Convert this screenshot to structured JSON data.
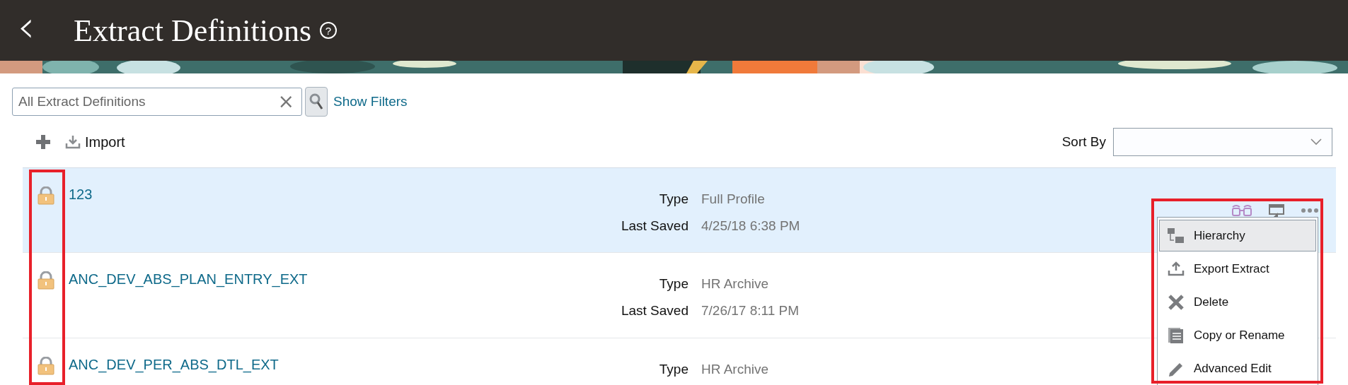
{
  "header": {
    "back": "‹",
    "title": "Extract Definitions",
    "help": "?"
  },
  "search": {
    "value": "All Extract Definitions",
    "clear": "×",
    "show_filters": "Show Filters"
  },
  "toolbar": {
    "import": "Import",
    "sort_label": "Sort By"
  },
  "rows": [
    {
      "name": "123",
      "locked": true,
      "selected": true,
      "fields": [
        {
          "label": "Type",
          "value": "Full Profile"
        },
        {
          "label": "Last Saved",
          "value": "4/25/18 6:38 PM"
        }
      ]
    },
    {
      "name": "ANC_DEV_ABS_PLAN_ENTRY_EXT",
      "locked": true,
      "selected": false,
      "fields": [
        {
          "label": "Type",
          "value": "HR Archive"
        },
        {
          "label": "Last Saved",
          "value": "7/26/17 8:11 PM"
        }
      ]
    },
    {
      "name": "ANC_DEV_PER_ABS_DTL_EXT",
      "locked": true,
      "selected": false,
      "fields": [
        {
          "label": "Type",
          "value": "HR Archive"
        }
      ]
    }
  ],
  "menu": [
    {
      "label": "Hierarchy",
      "kind": "hierarchy",
      "selected": true
    },
    {
      "label": "Export Extract",
      "kind": "export",
      "selected": false
    },
    {
      "label": "Delete",
      "kind": "delete",
      "selected": false
    },
    {
      "label": "Copy or Rename",
      "kind": "copy",
      "selected": false
    },
    {
      "label": "Advanced Edit",
      "kind": "edit",
      "selected": false
    }
  ]
}
